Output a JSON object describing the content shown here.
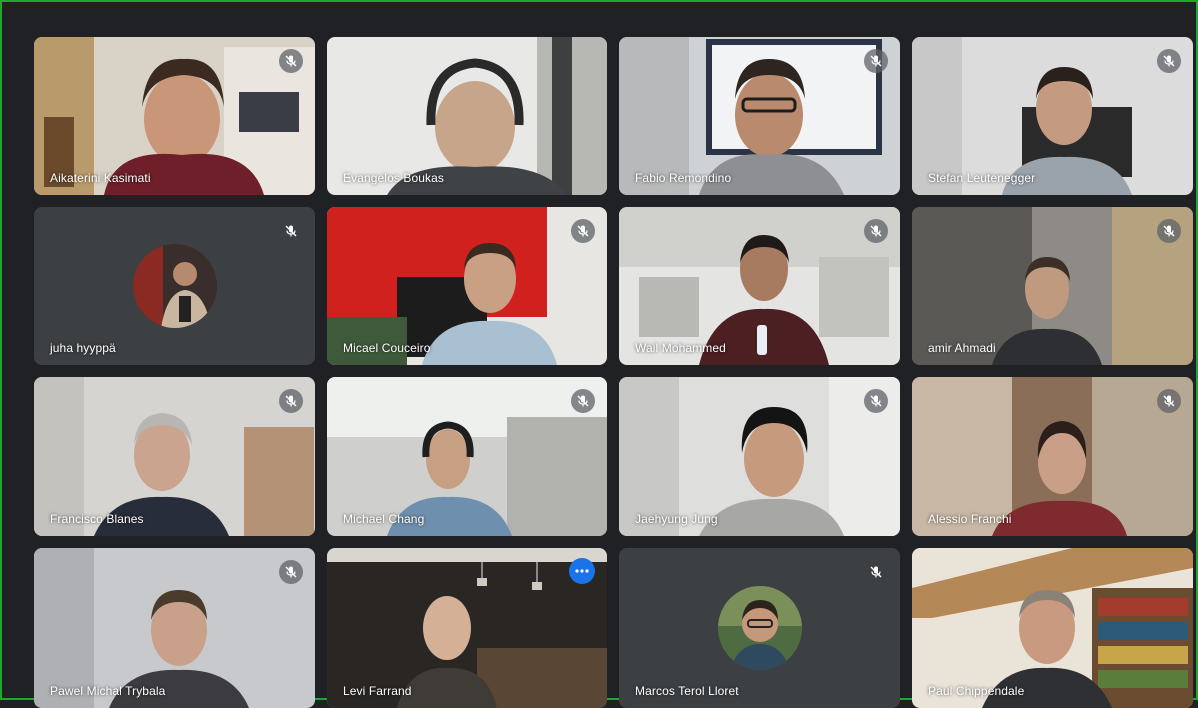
{
  "colors": {
    "background": "#202124",
    "tile_placeholder": "#3c4043",
    "active_outline": "#8ab4f8",
    "more_button": "#1a73e8",
    "window_border": "#1fa82e"
  },
  "participants": [
    {
      "name": "Aikaterini Kasimati",
      "muted": true,
      "video": true
    },
    {
      "name": "Evangelos Boukas",
      "muted": false,
      "video": true
    },
    {
      "name": "Fabio Remondino",
      "muted": true,
      "video": true
    },
    {
      "name": "Stefan Leutenegger",
      "muted": true,
      "video": true
    },
    {
      "name": "juha hyyppä",
      "muted": true,
      "video": false
    },
    {
      "name": "Micael Couceiro",
      "muted": true,
      "video": true
    },
    {
      "name": "Wail Mohammed",
      "muted": true,
      "video": true
    },
    {
      "name": "amir Ahmadi",
      "muted": true,
      "video": true
    },
    {
      "name": "Francisco Blanes",
      "muted": true,
      "video": true
    },
    {
      "name": "Michael Chang",
      "muted": true,
      "video": true
    },
    {
      "name": "Jaehyung Jung",
      "muted": true,
      "video": true
    },
    {
      "name": "Alessio Franchi",
      "muted": true,
      "video": true
    },
    {
      "name": "Pawel Michal Trybala",
      "muted": true,
      "video": true
    },
    {
      "name": "Levi Farrand",
      "muted": false,
      "video": true,
      "active": true
    },
    {
      "name": "Marcos Terol Lloret",
      "muted": true,
      "video": false
    },
    {
      "name": "Paul Chippendale",
      "muted": false,
      "video": true
    }
  ],
  "icons": {
    "mute": "mic-off-icon",
    "more": "more-options-icon"
  }
}
